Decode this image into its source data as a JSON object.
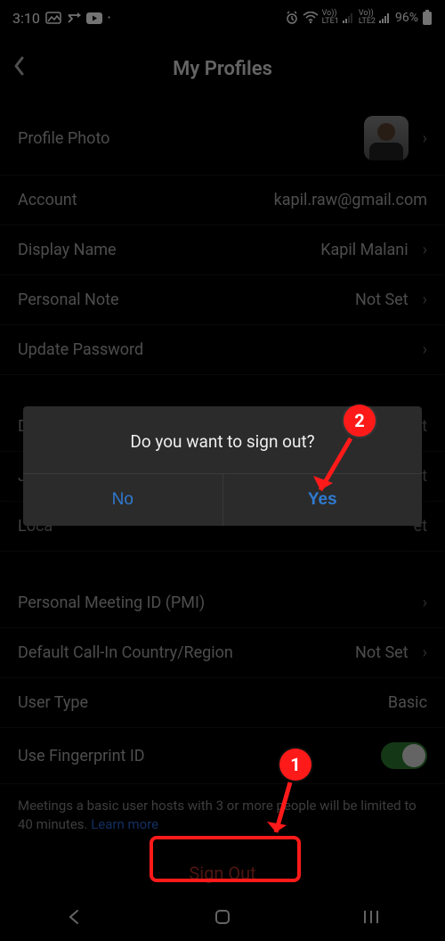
{
  "status": {
    "time": "3:10",
    "battery": "96%",
    "lte1": "LTE1",
    "lte2": "LTE2"
  },
  "header": {
    "title": "My Profiles"
  },
  "rows": {
    "profile_photo": "Profile Photo",
    "account_label": "Account",
    "account_value": "kapil.raw@gmail.com",
    "display_name_label": "Display Name",
    "display_name_value": "Kapil Malani",
    "personal_note_label": "Personal Note",
    "personal_note_value": "Not Set",
    "update_password": "Update Password",
    "department_label": "Depa",
    "department_value": "et",
    "job_label": "Job",
    "job_value": "et",
    "location_label": "Loca",
    "location_value": "et",
    "pmi_label": "Personal Meeting ID (PMI)",
    "callin_label": "Default Call-In Country/Region",
    "callin_value": "Not Set",
    "usertype_label": "User Type",
    "usertype_value": "Basic",
    "fingerprint_label": "Use Fingerprint ID"
  },
  "note": {
    "text": "Meetings a basic user hosts with 3 or more people will be limited to 40 minutes. ",
    "link": "Learn more"
  },
  "signout": "Sign Out",
  "dialog": {
    "message": "Do you want to sign out?",
    "no": "No",
    "yes": "Yes"
  },
  "annotations": {
    "step1": "1",
    "step2": "2"
  }
}
